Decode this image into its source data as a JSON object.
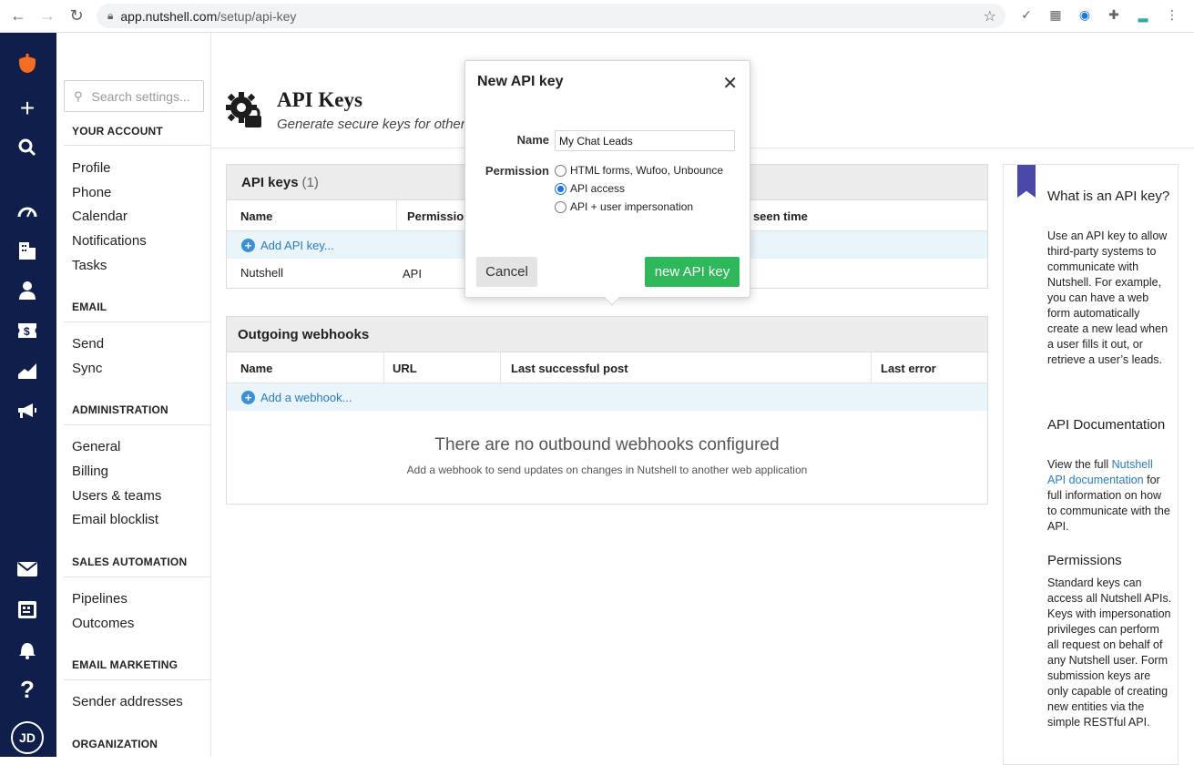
{
  "browser": {
    "url_host": "app.nutshell.com",
    "url_path": "/setup/api-key"
  },
  "search": {
    "placeholder": "Search settings..."
  },
  "sidebar": {
    "sections": [
      {
        "title": "YOUR ACCOUNT",
        "items": [
          "Profile",
          "Phone",
          "Calendar",
          "Notifications",
          "Tasks"
        ]
      },
      {
        "title": "EMAIL",
        "items": [
          "Send",
          "Sync"
        ]
      },
      {
        "title": "ADMINISTRATION",
        "items": [
          "General",
          "Billing",
          "Users & teams",
          "Email blocklist"
        ]
      },
      {
        "title": "SALES AUTOMATION",
        "items": [
          "Pipelines",
          "Outcomes"
        ]
      },
      {
        "title": "EMAIL MARKETING",
        "items": [
          "Sender addresses"
        ]
      },
      {
        "title": "ORGANIZATION",
        "items": []
      }
    ]
  },
  "rail": {
    "avatar": "JD"
  },
  "page": {
    "title": "API Keys",
    "subtitle": "Generate secure keys for other a"
  },
  "api_keys": {
    "title": "API keys",
    "count": "(1)",
    "columns": [
      "Name",
      "Permissio",
      "t seen time"
    ],
    "add_label": "Add API key...",
    "rows": [
      {
        "name": "Nutshell",
        "permission": "API"
      }
    ]
  },
  "webhooks": {
    "title": "Outgoing webhooks",
    "columns": [
      "Name",
      "URL",
      "Last successful post",
      "Last error"
    ],
    "add_label": "Add a webhook...",
    "empty_title": "There are no outbound webhooks configured",
    "empty_sub": "Add a webhook to send updates on changes in Nutshell to another web application"
  },
  "help": {
    "h1": "What is an API key?",
    "p1": "Use an API key to allow third-party systems to communicate with Nutshell. For example, you can have a web form automatically create a new lead when a user fills it out, or retrieve a user’s leads.",
    "h2": "API Documentation",
    "p2_pre": "View the full ",
    "p2_link": "Nutshell API documentation",
    "p2_post": " for full information on how to communicate with the API.",
    "h3": "Permissions",
    "p3": "Standard keys can access all Nutshell APIs. Keys with impersonation privileges can perform all request on behalf of any Nutshell user. Form submission keys are only capable of creating new entities via the simple RESTful API."
  },
  "modal": {
    "title": "New API key",
    "name_label": "Name",
    "name_value": "My Chat Leads",
    "permission_label": "Permission",
    "options": [
      "HTML forms, Wufoo, Unbounce",
      "API access",
      "API + user impersonation"
    ],
    "selected_option": "API access",
    "cancel_label": "Cancel",
    "create_label": "new API key"
  },
  "colors": {
    "rail": "#0f1e4a",
    "accent_green": "#2fb85a",
    "link_blue": "#2a7bbd",
    "brand_orange": "#f26d21"
  }
}
